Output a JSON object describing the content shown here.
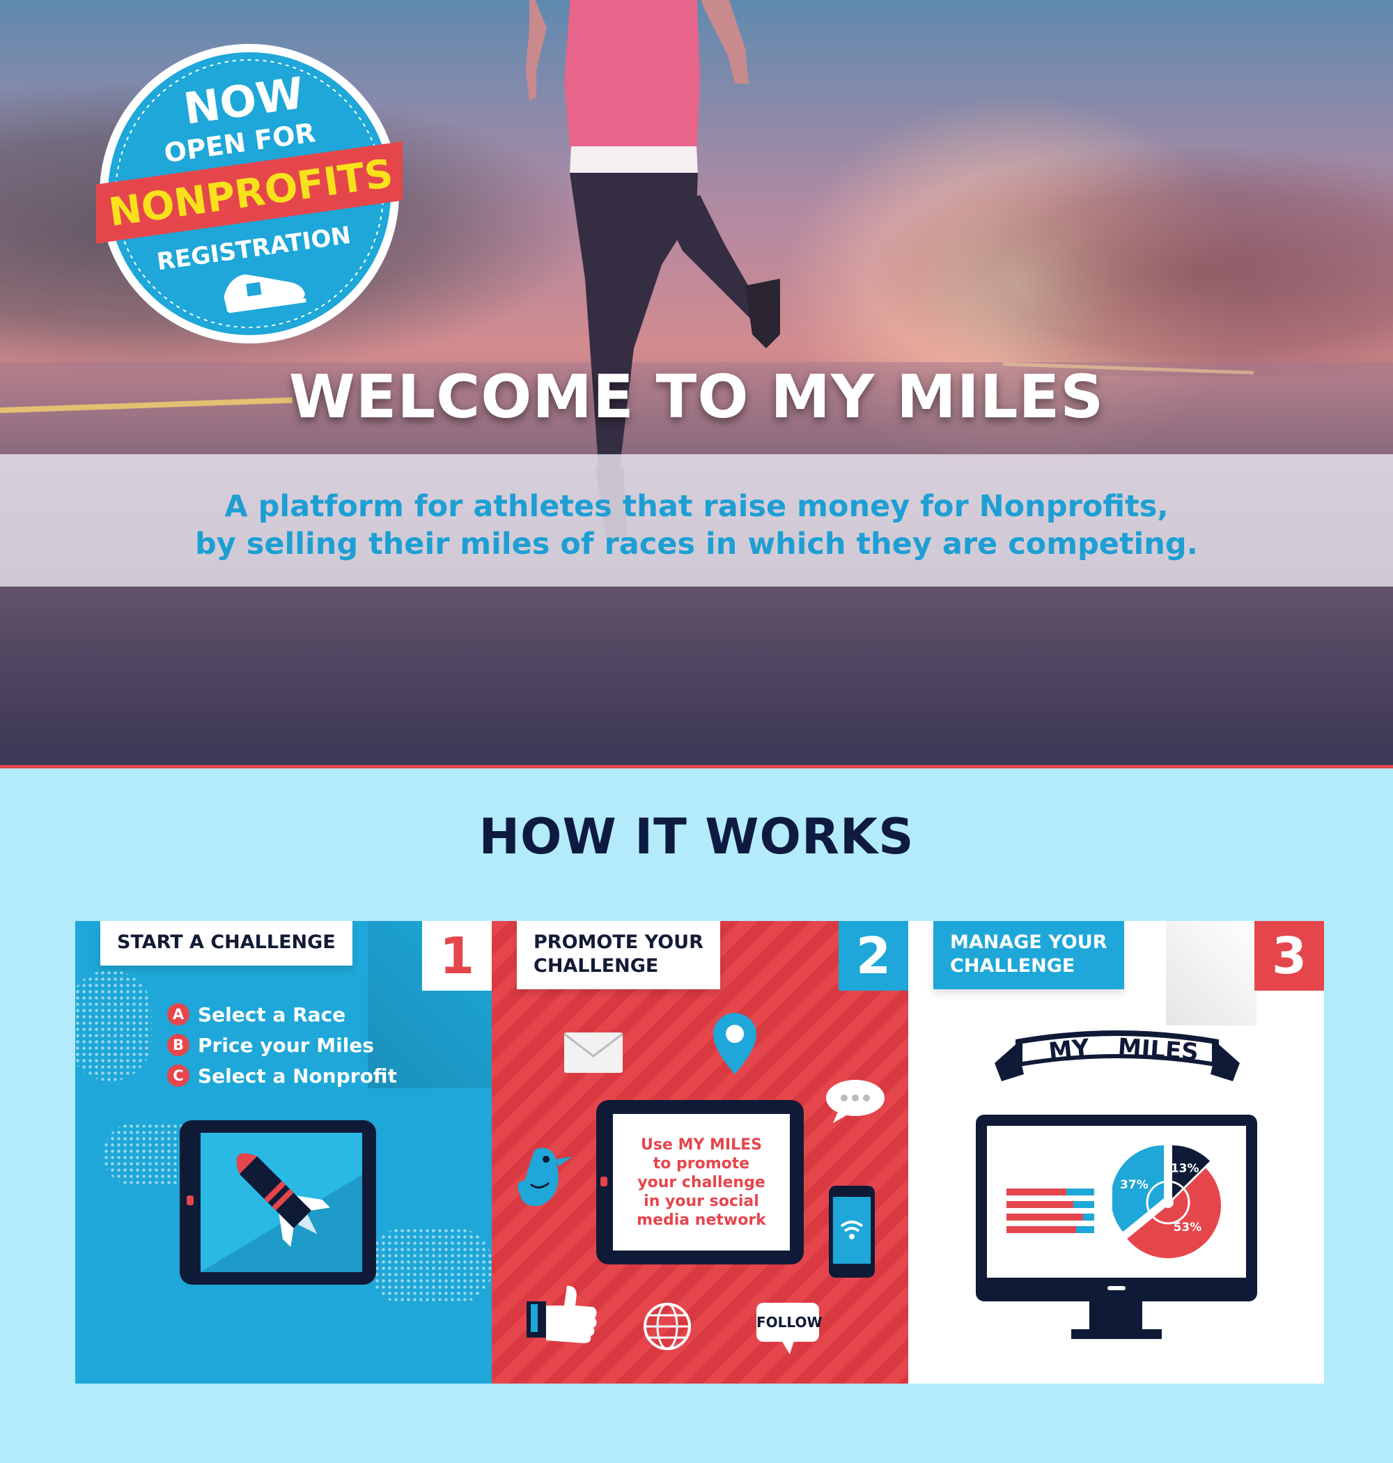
{
  "hero": {
    "title": "WELCOME TO MY MILES",
    "subtitle_line1": "A platform for athletes that raise money for Nonprofits,",
    "subtitle_line2": "by selling their miles of races in which they are competing."
  },
  "badge": {
    "line1": "NOW",
    "line2": "OPEN FOR",
    "banner": "NONPROFITS",
    "line3": "REGISTRATION",
    "icon": "running-shoe-icon"
  },
  "how_it_works": {
    "title": "HOW IT WORKS",
    "panels": [
      {
        "label": "START A CHALLENGE",
        "number": "1",
        "steps": [
          {
            "letter": "A",
            "text": "Select a Race"
          },
          {
            "letter": "B",
            "text": "Price your Miles"
          },
          {
            "letter": "C",
            "text": "Select a Nonprofit"
          }
        ],
        "icons": [
          "tablet-icon",
          "rocket-icon"
        ]
      },
      {
        "label_line1": "PROMOTE YOUR",
        "label_line2": "CHALLENGE",
        "number": "2",
        "tablet_text": "Use MY MILES to promote your challenge in your social media network",
        "follow_label": "FOLLOW",
        "icons": [
          "envelope-icon",
          "location-pin-icon",
          "chat-bubble-icon",
          "bird-icon",
          "smartphone-icon",
          "thumbs-up-icon",
          "globe-icon"
        ]
      },
      {
        "label_line1": "MANAGE YOUR",
        "label_line2": "CHALLENGE",
        "number": "3",
        "logo_left": "MY",
        "logo_right": "MILES",
        "pie": {
          "values": [
            37,
            13,
            53
          ],
          "labels": [
            "37%",
            "13%",
            "53%"
          ]
        },
        "icons": [
          "monitor-icon",
          "bar-chart-icon",
          "pie-chart-icon"
        ]
      }
    ]
  },
  "colors": {
    "blue": "#1ea7d8",
    "red": "#e5464c",
    "navy": "#0f1a37",
    "light_blue_bg": "#b3ebfb",
    "yellow": "#f9e21b"
  }
}
